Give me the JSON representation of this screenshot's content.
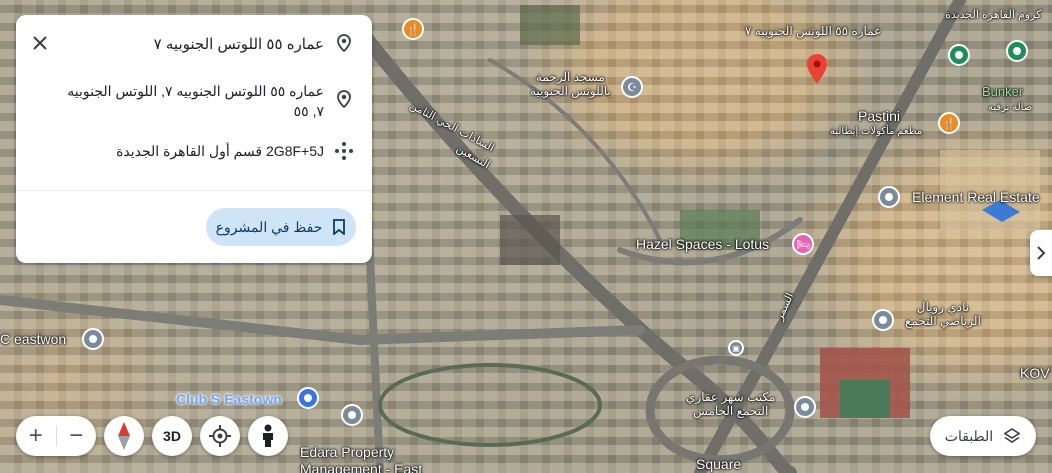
{
  "place_card": {
    "title": "عماره ٥٥ اللوتس الجنوبيه ٧",
    "address": "عماره ٥٥ اللوتس الجنوبيه ٧, اللوتس الجنوبيه ٧, ٥٥",
    "plus_code": "2G8F+5J قسم أول القاهرة الجديدة",
    "save_label": "حفظ في المشروع"
  },
  "map_labels": {
    "selected_place": "عماره ٥٥ اللوتس الجنوبيه ٧",
    "mosque": "مسجد الرحمة\nباللوتس الجنوبية",
    "pastini": "Pastini",
    "pastini_sub": "مطعم مأكولات إيطالية",
    "element": "Element Real Estate",
    "hazel": "Hazel Spaces - Lotus",
    "bunker": "Bunker",
    "bunker_sub": "صالة ترفيه",
    "cairo_top": "كروم القاهرة الجديدة",
    "road1": "السادات الحي الثامن",
    "road2": "التسعين",
    "road3": "السمر",
    "eastwon": "C eastwon",
    "club": "Club S Eastown",
    "edara": "Edara Property",
    "edara2": "Management - East",
    "royal": "نادي رويال\nالرياضي التجمع",
    "realestate": "مكتب شهر عقاري\nالتجمع الخامس",
    "square": "Square",
    "kov": "KOV"
  },
  "controls": {
    "zoom_in": "+",
    "zoom_out": "−",
    "btn_3d": "3D",
    "layers_label": "الطبقات"
  },
  "colors": {
    "accent": "#1a73e8",
    "save_bg": "#cfe5f7",
    "pin_red": "#ea4335"
  }
}
